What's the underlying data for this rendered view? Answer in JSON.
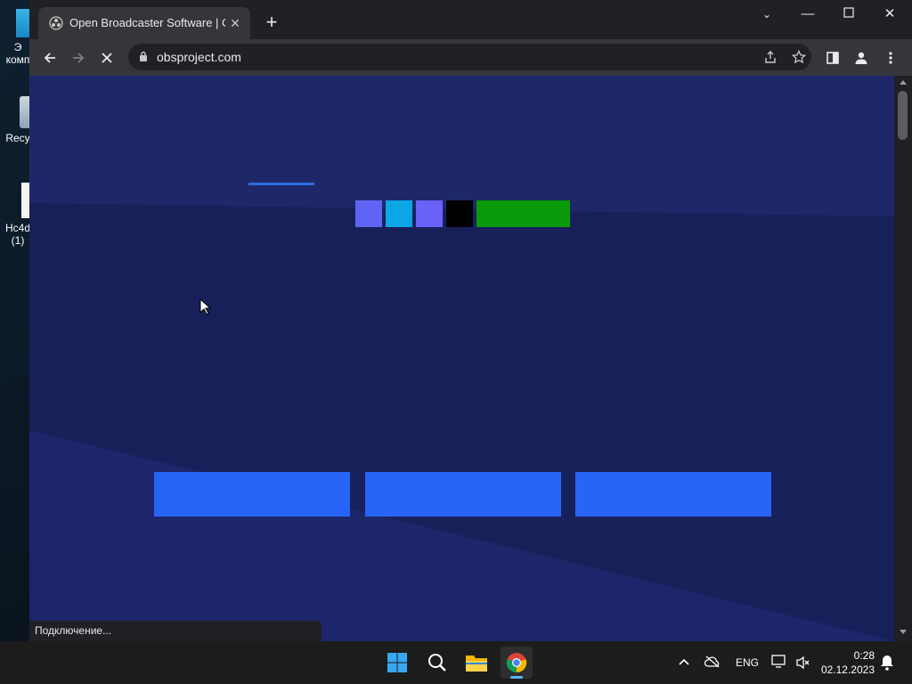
{
  "desktop": {
    "icons": [
      {
        "label": "Э\nкомп"
      },
      {
        "label": "Recy"
      },
      {
        "label": "Hc4d\n(1)"
      }
    ]
  },
  "browser": {
    "tab": {
      "title": "Open Broadcaster Software | OB",
      "favicon": "obs-icon"
    },
    "url": "obsproject.com",
    "status_text": "Подключение..."
  },
  "page": {
    "colors": {
      "bg_top": "#1c2465",
      "bg_main": "#18205a",
      "accent_line": "#2d6be0",
      "blocks": [
        "#6064f4",
        "#0aa6e6",
        "#6a62f8",
        "#000000",
        "#0a9a0a"
      ],
      "buttons": "#2864f8"
    }
  },
  "taskbar": {
    "language": "ENG",
    "time": "0:28",
    "date": "02.12.2023"
  }
}
